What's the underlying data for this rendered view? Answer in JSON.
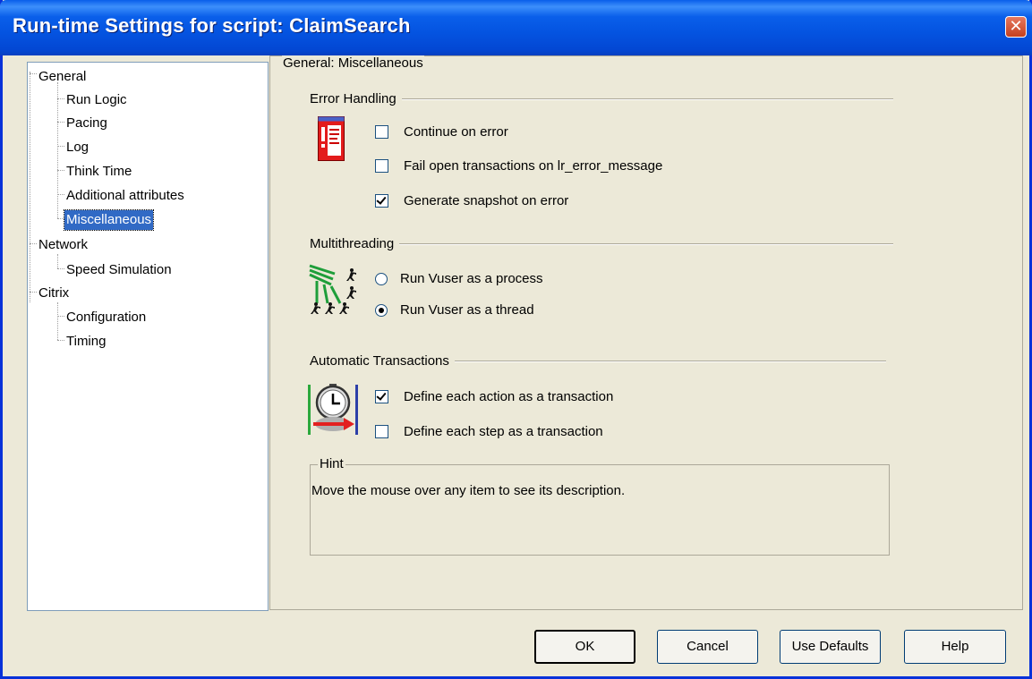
{
  "window": {
    "title": "Run-time Settings for script: ClaimSearch",
    "close_glyph": "✕"
  },
  "tree": {
    "items": [
      {
        "label": "General"
      },
      {
        "label": "Run Logic"
      },
      {
        "label": "Pacing"
      },
      {
        "label": "Log"
      },
      {
        "label": "Think Time"
      },
      {
        "label": "Additional attributes"
      },
      {
        "label": "Miscellaneous"
      },
      {
        "label": "Network"
      },
      {
        "label": "Speed Simulation"
      },
      {
        "label": "Citrix"
      },
      {
        "label": "Configuration"
      },
      {
        "label": "Timing"
      }
    ],
    "selected": "Miscellaneous"
  },
  "panel": {
    "title": "General: Miscellaneous",
    "error_handling": {
      "label": "Error Handling",
      "icon": "error-document-icon",
      "options": [
        {
          "label": "Continue on error",
          "checked": false
        },
        {
          "label": "Fail open transactions on lr_error_message",
          "checked": false
        },
        {
          "label": "Generate snapshot on error",
          "checked": true
        }
      ]
    },
    "multithreading": {
      "label": "Multithreading",
      "icon": "multithread-runners-icon",
      "options": [
        {
          "label": "Run Vuser as a process",
          "selected": false
        },
        {
          "label": "Run Vuser as a thread",
          "selected": true
        }
      ]
    },
    "automatic_transactions": {
      "label": "Automatic Transactions",
      "icon": "stopwatch-transaction-icon",
      "options": [
        {
          "label": "Define each action as a transaction",
          "checked": true
        },
        {
          "label": "Define each step as a transaction",
          "checked": false
        }
      ]
    },
    "hint": {
      "label": "Hint",
      "text": "Move the mouse over any item to see its description."
    }
  },
  "buttons": {
    "ok": "OK",
    "cancel": "Cancel",
    "use_defaults": "Use Defaults",
    "help": "Help"
  },
  "colors": {
    "title_bar": "#0A5FEA",
    "selection": "#316AC5",
    "dialog_bg": "#ECE9D8"
  }
}
